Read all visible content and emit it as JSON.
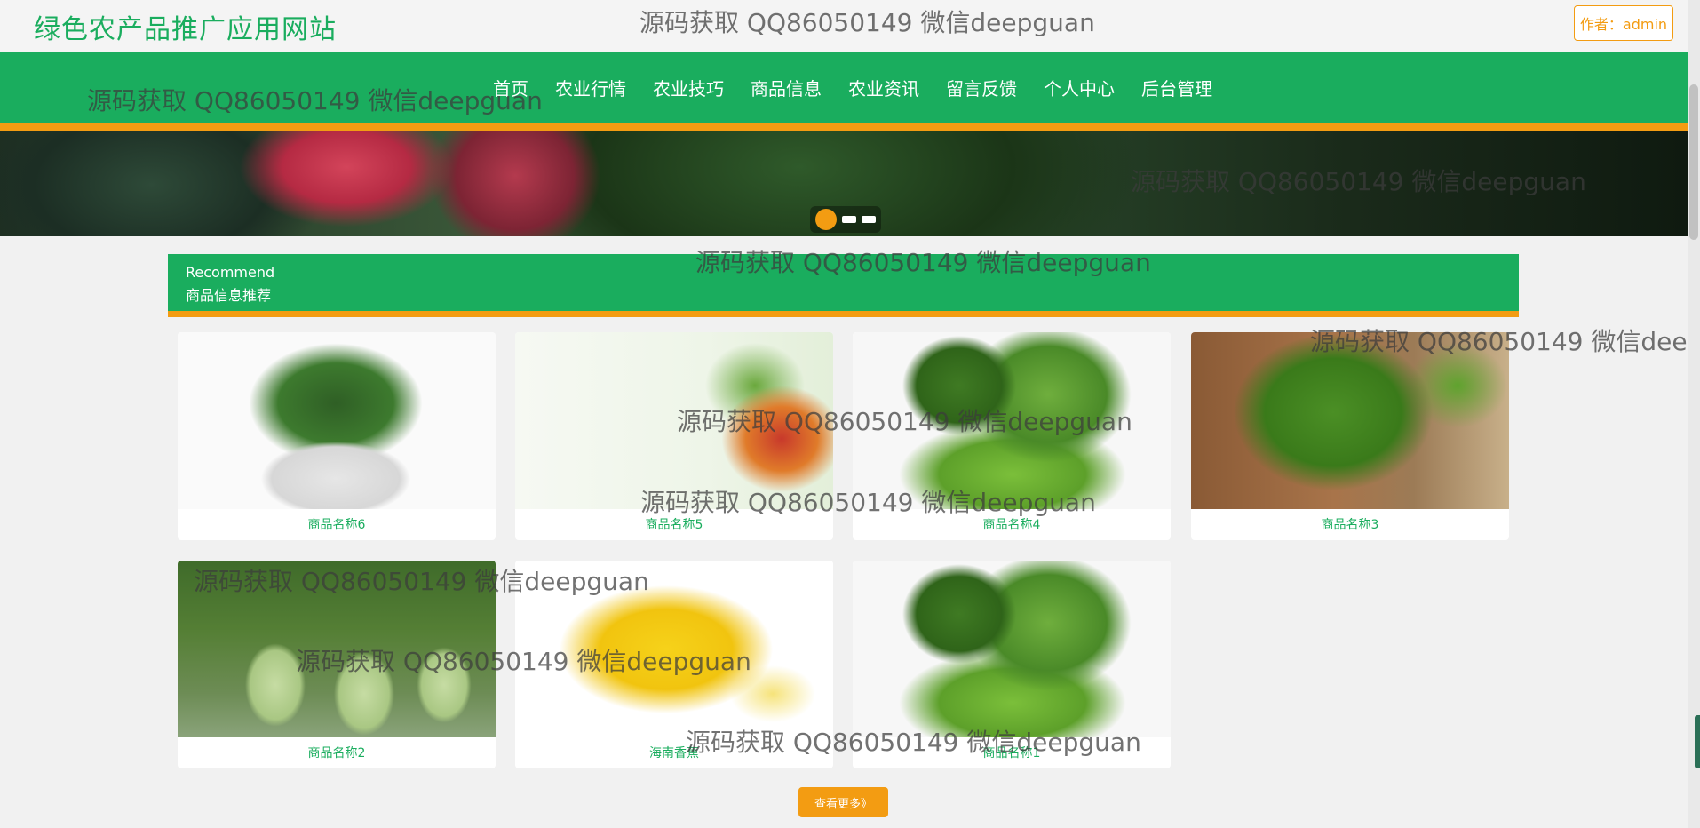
{
  "header": {
    "site_title": "绿色农产品推广应用网站",
    "author_label": "作者：admin"
  },
  "nav": {
    "items": [
      "首页",
      "农业行情",
      "农业技巧",
      "商品信息",
      "农业资讯",
      "留言反馈",
      "个人中心",
      "后台管理"
    ]
  },
  "banner": {
    "slide_count": 3,
    "active_index": 0
  },
  "section": {
    "title_en": "Recommend",
    "title_cn": "商品信息推荐"
  },
  "products": [
    {
      "name": "商品名称6",
      "image": "bok-choy-photo"
    },
    {
      "name": "商品名称5",
      "image": "fresh-vegetables-poster"
    },
    {
      "name": "商品名称4",
      "image": "broccoli-vegetables-photo"
    },
    {
      "name": "商品名称3",
      "image": "broccoli-bowl-photo"
    },
    {
      "name": "商品名称2",
      "image": "gourd-vine-photo"
    },
    {
      "name": "海南香蕉",
      "image": "banana-photo"
    },
    {
      "name": "商品名称1",
      "image": "broccoli-vegetables-photo"
    }
  ],
  "more_button": "查看更多》",
  "watermark_text": "源码获取 QQ86050149 微信deepguan",
  "colors": {
    "brand_green": "#1aad5e",
    "accent_orange": "#f39c12"
  }
}
